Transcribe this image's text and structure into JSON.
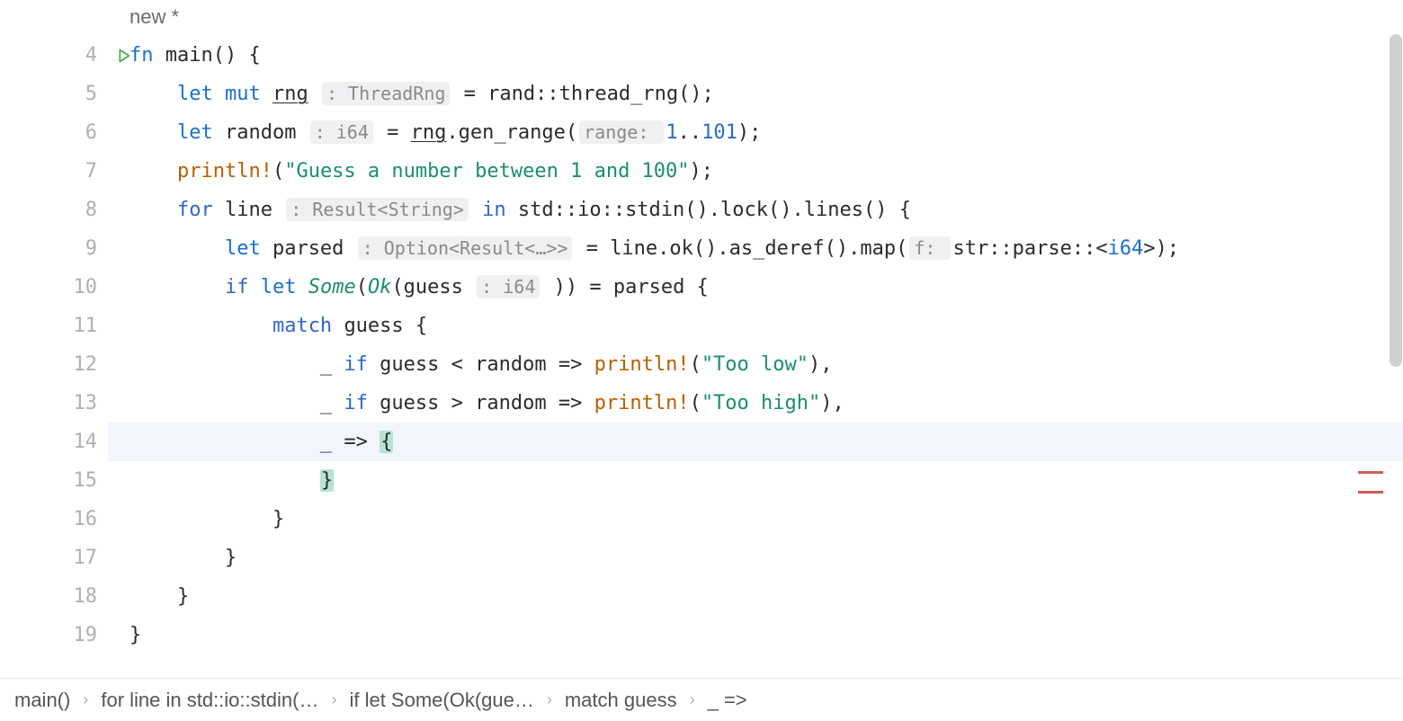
{
  "tab": {
    "title": "new *"
  },
  "gutter": {
    "start": 4,
    "end": 19,
    "run_line": 4,
    "active_line": 14
  },
  "code": {
    "lines": [
      {
        "n": 4,
        "indent": 0,
        "tokens": [
          [
            "kw",
            "fn "
          ],
          [
            "fn-name",
            "main"
          ],
          [
            "paren",
            "() {"
          ]
        ]
      },
      {
        "n": 5,
        "indent": 1,
        "tokens": [
          [
            "kw",
            "let "
          ],
          [
            "kw",
            "mut "
          ],
          [
            "underline",
            "rng"
          ],
          [
            "sp",
            " "
          ],
          [
            "hint",
            ": ThreadRng"
          ],
          [
            "plain",
            " = rand::thread_rng();"
          ]
        ]
      },
      {
        "n": 6,
        "indent": 1,
        "tokens": [
          [
            "kw",
            "let "
          ],
          [
            "plain",
            "random "
          ],
          [
            "hint",
            ": i64"
          ],
          [
            "plain",
            " = "
          ],
          [
            "underline",
            "rng"
          ],
          [
            "plain",
            ".gen_range("
          ],
          [
            "hint",
            "range: "
          ],
          [
            "num",
            "1"
          ],
          [
            "plain",
            ".."
          ],
          [
            "num",
            "101"
          ],
          [
            "plain",
            ");"
          ]
        ]
      },
      {
        "n": 7,
        "indent": 1,
        "tokens": [
          [
            "macro",
            "println!"
          ],
          [
            "plain",
            "("
          ],
          [
            "str",
            "\"Guess a number between 1 and 100\""
          ],
          [
            "plain",
            ");"
          ]
        ]
      },
      {
        "n": 8,
        "indent": 1,
        "tokens": [
          [
            "kw-ctrl",
            "for "
          ],
          [
            "plain",
            "line "
          ],
          [
            "hint",
            ": Result<String>"
          ],
          [
            "plain",
            " "
          ],
          [
            "kw-ctrl",
            "in "
          ],
          [
            "plain",
            "std::io::stdin().lock().lines() {"
          ]
        ]
      },
      {
        "n": 9,
        "indent": 2,
        "tokens": [
          [
            "kw",
            "let "
          ],
          [
            "plain",
            "parsed "
          ],
          [
            "hint",
            ": Option<Result<…>>"
          ],
          [
            "plain",
            " = line.ok().as_deref().map("
          ],
          [
            "hint",
            "f: "
          ],
          [
            "plain",
            "str::parse::<"
          ],
          [
            "kw",
            "i64"
          ],
          [
            "plain",
            ">);"
          ]
        ]
      },
      {
        "n": 10,
        "indent": 2,
        "tokens": [
          [
            "kw-ctrl",
            "if "
          ],
          [
            "kw",
            "let "
          ],
          [
            "type",
            "Some"
          ],
          [
            "plain",
            "("
          ],
          [
            "type",
            "Ok"
          ],
          [
            "plain",
            "(guess "
          ],
          [
            "hint",
            ": i64"
          ],
          [
            "plain",
            " )) = parsed {"
          ]
        ]
      },
      {
        "n": 11,
        "indent": 3,
        "tokens": [
          [
            "kw-ctrl",
            "match "
          ],
          [
            "plain",
            "guess {"
          ]
        ]
      },
      {
        "n": 12,
        "indent": 4,
        "tokens": [
          [
            "plain",
            "_ "
          ],
          [
            "kw-ctrl",
            "if "
          ],
          [
            "plain",
            "guess < random => "
          ],
          [
            "macro",
            "println!"
          ],
          [
            "plain",
            "("
          ],
          [
            "str",
            "\"Too low\""
          ],
          [
            "plain",
            "),"
          ]
        ]
      },
      {
        "n": 13,
        "indent": 4,
        "tokens": [
          [
            "plain",
            "_ "
          ],
          [
            "kw-ctrl",
            "if "
          ],
          [
            "plain",
            "guess > random => "
          ],
          [
            "macro",
            "println!"
          ],
          [
            "plain",
            "("
          ],
          [
            "str",
            "\"Too high\""
          ],
          [
            "plain",
            "),"
          ]
        ]
      },
      {
        "n": 14,
        "indent": 4,
        "tokens": [
          [
            "plain",
            "_ => "
          ],
          [
            "bracket-match",
            "{"
          ]
        ]
      },
      {
        "n": 15,
        "indent": 4,
        "tokens": [
          [
            "bracket-match",
            "}"
          ]
        ]
      },
      {
        "n": 16,
        "indent": 3,
        "tokens": [
          [
            "plain",
            "}"
          ]
        ]
      },
      {
        "n": 17,
        "indent": 2,
        "tokens": [
          [
            "plain",
            "}"
          ]
        ]
      },
      {
        "n": 18,
        "indent": 1,
        "tokens": [
          [
            "plain",
            "}"
          ]
        ]
      },
      {
        "n": 19,
        "indent": 0,
        "tokens": [
          [
            "plain",
            "}"
          ]
        ]
      }
    ]
  },
  "breadcrumb": [
    "main()",
    "for line in std::io::stdin(…",
    "if let Some(Ok(gue…",
    "match guess",
    "_ =>"
  ],
  "error_markers": [
    486,
    508
  ]
}
